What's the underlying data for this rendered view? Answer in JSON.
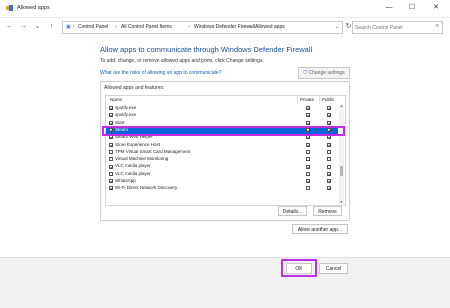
{
  "window": {
    "title": "Allowed apps",
    "minimize": "—",
    "maximize": "☐",
    "close": "✕"
  },
  "nav": {
    "back": "←",
    "forward": "→",
    "down": "⌄",
    "up": "↑",
    "breadcrumbs": [
      "Control Panel",
      "All Control Panel Items",
      "Windows Defender Firewall",
      "Allowed apps"
    ],
    "separator": "›",
    "refresh": "↻",
    "search_placeholder": "Search Control Panel"
  },
  "main": {
    "heading": "Allow apps to communicate through Windows Defender Firewall",
    "subtext": "To add, change, or remove allowed apps and ports, click Change settings.",
    "risk_link": "What are the risks of allowing an app to communicate?",
    "change_settings": "Change settings",
    "group_label": "Allowed apps and features:",
    "columns": {
      "name": "Name",
      "private": "Private",
      "public": "Public"
    },
    "check_glyph": "✔",
    "rows": [
      {
        "name": "spotify.exe",
        "enabled": true,
        "private": true,
        "public": true
      },
      {
        "name": "spotify.exe",
        "enabled": true,
        "private": true,
        "public": true
      },
      {
        "name": "Start",
        "enabled": true,
        "private": true,
        "public": true
      },
      {
        "name": "Steam",
        "enabled": true,
        "private": true,
        "public": true,
        "selected": true
      },
      {
        "name": "Steam Web Helper",
        "enabled": true,
        "private": true,
        "public": true
      },
      {
        "name": "Store Experience Host",
        "enabled": true,
        "private": true,
        "public": true
      },
      {
        "name": "TPM Virtual Smart Card Management",
        "enabled": false,
        "private": false,
        "public": false
      },
      {
        "name": "Virtual Machine Monitoring",
        "enabled": false,
        "private": false,
        "public": false
      },
      {
        "name": "VLC media player",
        "enabled": true,
        "private": true,
        "public": false
      },
      {
        "name": "VLC media player",
        "enabled": false,
        "private": false,
        "public": true
      },
      {
        "name": "WhatsApp",
        "enabled": true,
        "private": true,
        "public": true
      },
      {
        "name": "Wi-Fi Direct Network Discovery",
        "enabled": true,
        "private": false,
        "public": true
      }
    ],
    "details": "Details...",
    "remove": "Remove",
    "allow_another": "Allow another app..."
  },
  "footer": {
    "ok": "OK",
    "cancel": "Cancel"
  },
  "colors": {
    "heading": "#1a4d9c",
    "selection": "#0a63d9",
    "highlight_outline": "#c22de3"
  }
}
